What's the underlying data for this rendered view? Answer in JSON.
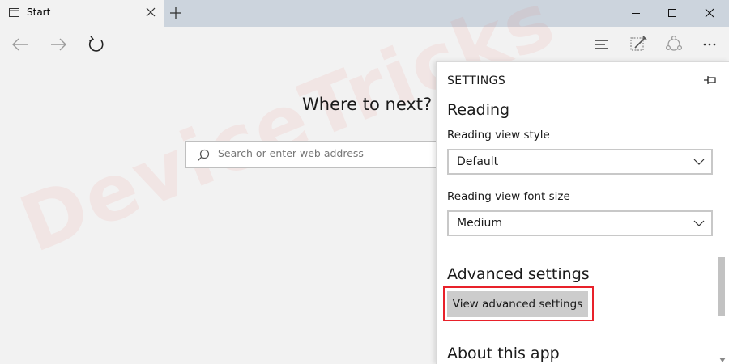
{
  "tab": {
    "title": "Start",
    "icon": "tab-page-icon",
    "close_icon": "close-icon"
  },
  "window": {
    "min_icon": "minimize-icon",
    "max_icon": "maximize-icon",
    "close_icon": "close-icon"
  },
  "nav": {
    "back_icon": "arrow-left-icon",
    "forward_icon": "arrow-right-icon",
    "refresh_icon": "refresh-icon",
    "hub_icon": "hub-icon",
    "note_icon": "web-note-icon",
    "share_icon": "share-icon",
    "more_icon": "more-icon"
  },
  "start": {
    "heading": "Where to next?",
    "search_placeholder": "Search or enter web address"
  },
  "watermark": "DeviceTricks",
  "settings": {
    "title": "SETTINGS",
    "reading": {
      "title": "Reading",
      "style_label": "Reading view style",
      "style_value": "Default",
      "font_label": "Reading view font size",
      "font_value": "Medium"
    },
    "advanced": {
      "title": "Advanced settings",
      "button_label": "View advanced settings"
    },
    "about": {
      "title": "About this app"
    }
  },
  "colors": {
    "highlight": "#e8212a",
    "titlebar": "#ccd4dd",
    "button": "#cccccc"
  }
}
